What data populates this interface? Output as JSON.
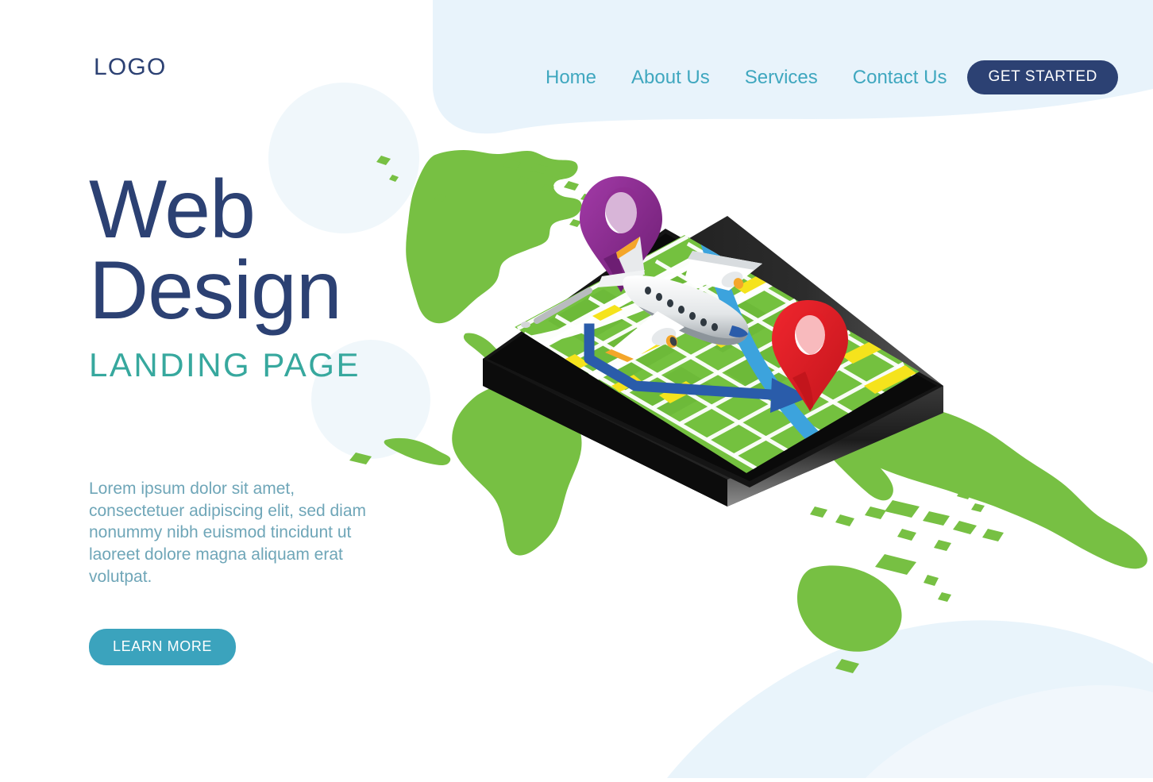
{
  "brand": {
    "logo_text": "LOGO",
    "navy": "#2c4173",
    "teal": "#3fa7bf",
    "teal_button": "#3ba3bd",
    "sub_teal": "#37a89e",
    "body_text": "#6fa6b8",
    "map_green": "#77c043",
    "pale_blue": "#e4f1fa"
  },
  "nav": {
    "items": [
      {
        "label": "Home"
      },
      {
        "label": "About Us"
      },
      {
        "label": "Services"
      },
      {
        "label": "Contact Us"
      }
    ],
    "cta_label": "GET STARTED"
  },
  "hero": {
    "title_line1": "Web",
    "title_line2": "Design",
    "subtitle": "LANDING PAGE",
    "paragraph": "Lorem ipsum dolor sit amet, consectetuer adipiscing elit, sed diam nonummy nibh euismod tincidunt ut laoreet dolore magna aliquam erat volutpat.",
    "cta_label": "LEARN MORE"
  },
  "illustration": {
    "world_map_label": "world-map",
    "device_label": "isometric-smartphone",
    "screen_label": "navigation-map-screen",
    "pins": [
      {
        "name": "purple-location-pin",
        "color": "#8e2b8e"
      },
      {
        "name": "red-location-pin",
        "color": "#e81c24"
      }
    ],
    "airplane_label": "airplane",
    "route_color": "#2a5caa",
    "river_color": "#3ca3dd",
    "block_color": "#f5e31c"
  },
  "icons": {
    "phone_speaker": "speaker-grille-icon",
    "phone_camera": "front-camera-icon"
  }
}
